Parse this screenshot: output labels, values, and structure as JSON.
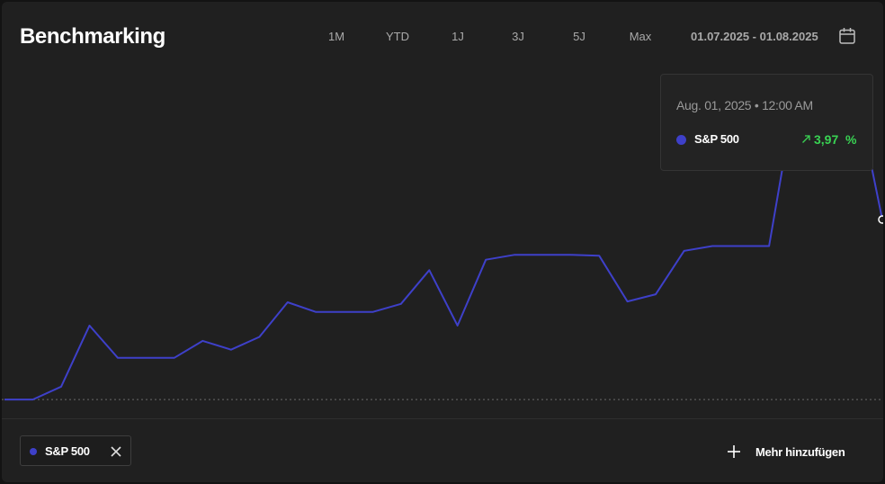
{
  "header": {
    "title": "Benchmarking",
    "ranges": [
      "1M",
      "YTD",
      "1J",
      "3J",
      "5J",
      "Max"
    ],
    "date_range": "01.07.2025 - 01.08.2025"
  },
  "tooltip": {
    "date": "Aug. 01, 2025 • 12:00 AM",
    "series_name": "S&P 500",
    "value": "3,97",
    "unit": "%"
  },
  "legend_chip": {
    "label": "S&P 500"
  },
  "footer": {
    "add_more_label": "Mehr hinzufügen"
  },
  "colors": {
    "series": "#3e40c9",
    "positive": "#39d353",
    "baseline": "#6a6a6a",
    "background": "#202020"
  },
  "chart_data": {
    "type": "line",
    "series": [
      {
        "name": "S&P 500",
        "x": [
          "2025-07-01",
          "2025-07-02",
          "2025-07-03",
          "2025-07-04",
          "2025-07-05",
          "2025-07-06",
          "2025-07-07",
          "2025-07-08",
          "2025-07-09",
          "2025-07-10",
          "2025-07-11",
          "2025-07-12",
          "2025-07-13",
          "2025-07-14",
          "2025-07-15",
          "2025-07-16",
          "2025-07-17",
          "2025-07-18",
          "2025-07-19",
          "2025-07-20",
          "2025-07-21",
          "2025-07-22",
          "2025-07-23",
          "2025-07-24",
          "2025-07-25",
          "2025-07-26",
          "2025-07-27",
          "2025-07-28",
          "2025-07-29",
          "2025-07-30",
          "2025-07-31",
          "2025-08-01"
        ],
        "values": [
          0.0,
          0.0,
          0.16,
          0.92,
          0.52,
          0.52,
          0.52,
          0.73,
          0.62,
          0.78,
          1.21,
          1.09,
          1.09,
          1.09,
          1.19,
          1.61,
          0.92,
          1.74,
          1.8,
          1.8,
          1.8,
          1.79,
          1.22,
          1.31,
          1.85,
          1.91,
          1.91,
          1.91,
          3.95,
          3.95,
          3.97,
          2.24
        ]
      }
    ],
    "ylim": [
      -0.2,
      4.3
    ],
    "baseline": 0,
    "grid": false,
    "legend": "bottom-left"
  }
}
